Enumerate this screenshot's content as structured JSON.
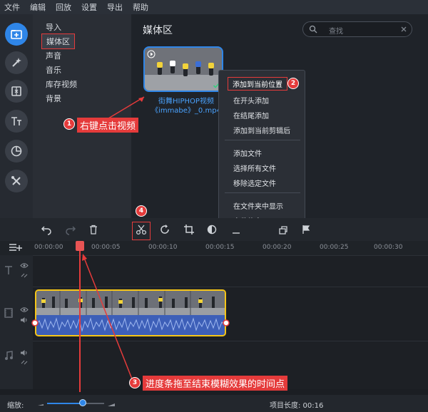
{
  "menubar": [
    "文件",
    "编辑",
    "回放",
    "设置",
    "导出",
    "帮助"
  ],
  "left_tools": [
    {
      "icon": "import-folder-icon",
      "active": true
    },
    {
      "icon": "magic-wand-icon",
      "active": false
    },
    {
      "icon": "transition-icon",
      "active": false
    },
    {
      "icon": "text-icon",
      "active": false
    },
    {
      "icon": "sticker-icon",
      "active": false
    },
    {
      "icon": "tools-icon",
      "active": false
    }
  ],
  "categories": [
    "导入",
    "媒体区",
    "声音",
    "音乐",
    "库存视频",
    "背景"
  ],
  "selected_category": "媒体区",
  "media": {
    "title": "媒体区",
    "search_placeholder": "查找",
    "file_caption_line1": "街舞HIPHOP视频",
    "file_caption_line2": "《immabe》_0.mp4"
  },
  "context_menu": {
    "group1": [
      "添加到当前位置",
      "在开头添加",
      "在结尾添加",
      "添加到当前剪辑后"
    ],
    "group2": [
      "添加文件",
      "选择所有文件",
      "移除选定文件"
    ],
    "group3": [
      "在文件夹中显示",
      "文件信息"
    ],
    "highlighted": "添加到当前位置"
  },
  "annotations": {
    "step1": {
      "num": "1",
      "text": "右键点击视频"
    },
    "step2": {
      "num": "2"
    },
    "step3": {
      "num": "3",
      "text": "进度条拖至结束模糊效果的时间点"
    },
    "step4": {
      "num": "4"
    }
  },
  "timeline": {
    "ruler_ticks": [
      "00:00:00",
      "00:00:05",
      "00:00:10",
      "00:00:15",
      "00:00:20",
      "00:00:25",
      "00:00:30"
    ],
    "toolbar_icons": [
      "undo-icon",
      "redo-icon",
      "delete-icon",
      "scissors-icon",
      "rotate-icon",
      "crop-icon",
      "color-icon",
      "audio-icon",
      "overlay-icon",
      "marker-icon"
    ]
  },
  "footer": {
    "zoom_label": "缩放:",
    "zoom_level": 0.62,
    "project_length_label": "项目长度: 00:16"
  },
  "colors": {
    "accent": "#2f86e8",
    "annotation": "#e53b3b",
    "clip_border": "#f5c518",
    "audio_wave": "#3d5fb8"
  }
}
